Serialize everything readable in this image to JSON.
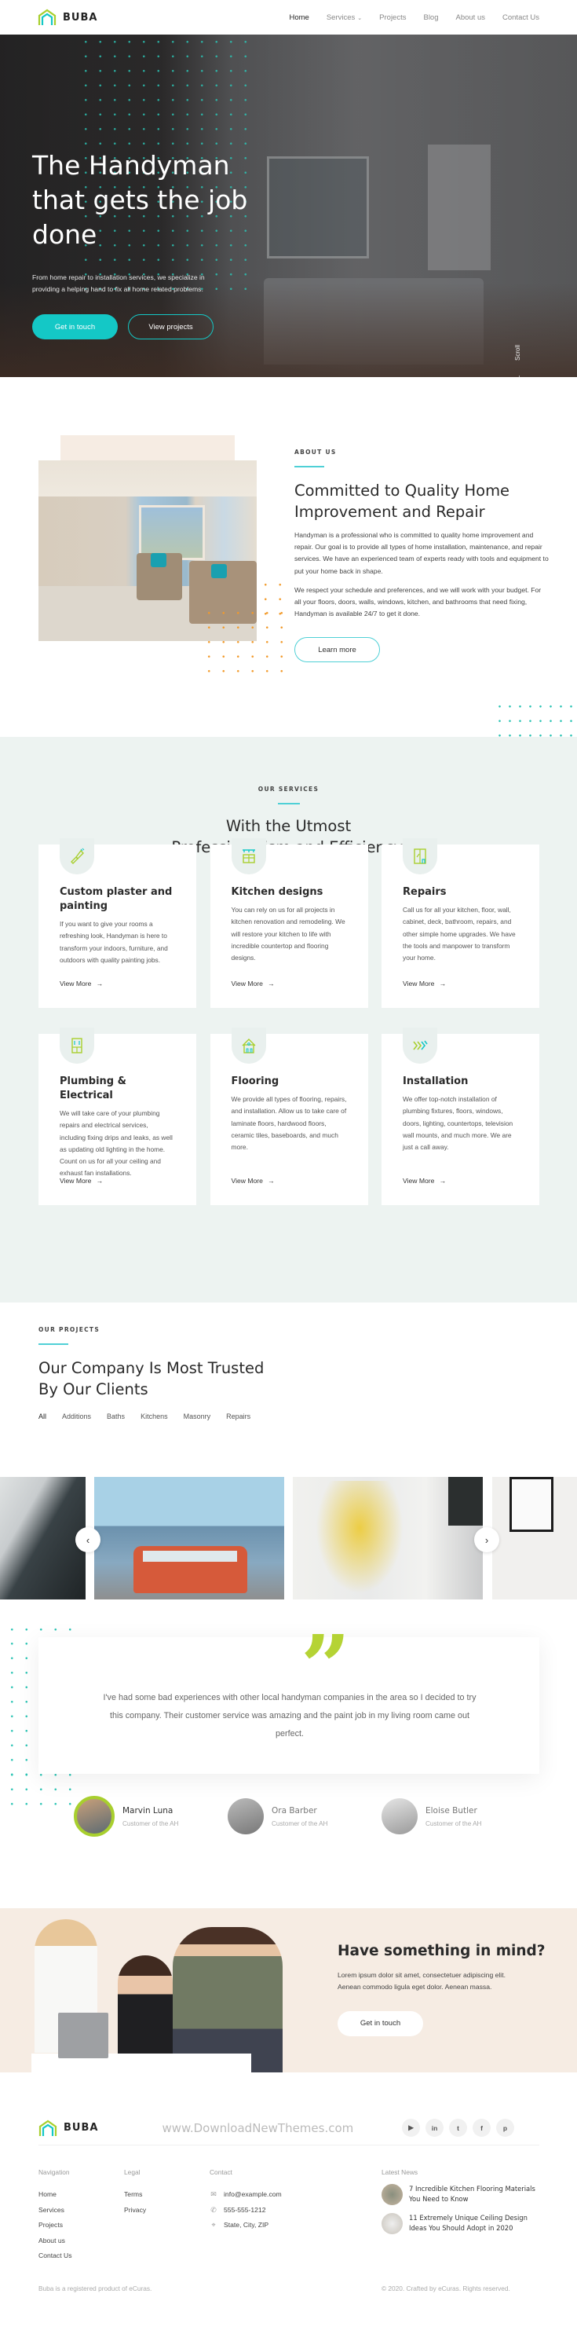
{
  "header": {
    "logo_text": "BUBA",
    "nav": [
      {
        "label": "Home",
        "active": true
      },
      {
        "label": "Services",
        "has_dropdown": true
      },
      {
        "label": "Projects"
      },
      {
        "label": "Blog"
      },
      {
        "label": "About us"
      },
      {
        "label": "Contact Us"
      }
    ],
    "dropdown_caret": "⌄"
  },
  "hero": {
    "title": "The Handyman that gets the job done",
    "subtitle": "From home repair to installation services, we specialize in providing a helping hand to fix all home related problems.",
    "primary_button": "Get in touch",
    "secondary_button": "View projects",
    "scroll_label": "Scroll"
  },
  "about": {
    "eyebrow": "ABOUT US",
    "title": "Committed to Quality Home Improvement and Repair",
    "paragraphs": [
      "Handyman is a professional who is committed to quality home improvement and repair. Our goal is to provide all types of home installation, maintenance, and repair services. We have an experienced team of experts ready with tools and equipment to put your home back in shape.",
      "We respect your schedule and preferences, and we will work with your budget. For all your floors, doors, walls, windows, kitchen, and bathrooms that need fixing, Handyman is available 24/7 to get it done."
    ],
    "button": "Learn more"
  },
  "services": {
    "eyebrow": "OUR SERVICES",
    "title_line1": "With the Utmost",
    "title_line2": "Professionalism and Efficiency.",
    "view_more_label": "View More",
    "arrow": "→",
    "items": [
      {
        "icon": "paint-brush-icon",
        "title": "Custom plaster and painting",
        "text": "If you want to give your rooms a refreshing look, Handyman is here to transform your indoors, furniture, and outdoors with quality painting jobs."
      },
      {
        "icon": "kitchen-cabinet-icon",
        "title": "Kitchen designs",
        "text": "You can rely on us for all projects in kitchen renovation and remodeling. We will restore your kitchen to life with incredible countertop and flooring designs."
      },
      {
        "icon": "window-repair-icon",
        "title": "Repairs",
        "text": "Call us for all your kitchen, floor, wall, cabinet, deck, bathroom, repairs, and other simple home upgrades. We have the tools and manpower to transform your home."
      },
      {
        "icon": "plumbing-cabinet-icon",
        "title": "Plumbing & Electrical",
        "text": "We will take care of your plumbing repairs and electrical services, including fixing drips and leaks, as well as updating old lighting in the home. Count on us for all your ceiling and exhaust fan installations."
      },
      {
        "icon": "house-icon",
        "title": "Flooring",
        "text": "We provide all types of flooring, repairs, and installation. Allow us to take care of laminate floors, hardwood floors, ceramic tiles, baseboards, and much more."
      },
      {
        "icon": "installation-icon",
        "title": "Installation",
        "text": "We offer top-notch installation of plumbing fixtures, floors, windows, doors, lighting, countertops, television wall mounts, and much more. We are just a call away."
      }
    ]
  },
  "projects": {
    "eyebrow": "OUR PROJECTS",
    "title_line1": "Our Company Is Most Trusted",
    "title_line2": "By Our Clients",
    "filters": [
      {
        "label": "All",
        "active": true
      },
      {
        "label": "Additions"
      },
      {
        "label": "Baths"
      },
      {
        "label": "Kitchens"
      },
      {
        "label": "Masonry"
      },
      {
        "label": "Repairs"
      }
    ],
    "prev_icon": "‹",
    "next_icon": "›"
  },
  "testimonials": {
    "quote_mark": "”",
    "quote": "I've had some bad experiences with other local handyman companies in the area so I decided to try this company. Their customer service was amazing and the paint job in my living room came out perfect.",
    "people": [
      {
        "name": "Marvin Luna",
        "role": "Customer of the AH",
        "active": true
      },
      {
        "name": "Ora Barber",
        "role": "Customer of the AH"
      },
      {
        "name": "Eloise Butler",
        "role": "Customer of the AH"
      }
    ]
  },
  "contact_cta": {
    "title": "Have something in mind?",
    "text": "Lorem ipsum dolor sit amet, consectetuer adipiscing elit. Aenean commodo ligula eget dolor. Aenean massa.",
    "button": "Get in touch"
  },
  "footer": {
    "logo_text": "BUBA",
    "watermark": "www.DownloadNewThemes.com",
    "socials": [
      {
        "name": "youtube",
        "glyph": "▶"
      },
      {
        "name": "linkedin",
        "glyph": "in"
      },
      {
        "name": "twitter",
        "glyph": "t"
      },
      {
        "name": "facebook",
        "glyph": "f"
      },
      {
        "name": "pinterest",
        "glyph": "p"
      }
    ],
    "navigation": {
      "heading": "Navigation",
      "items": [
        "Home",
        "Services",
        "Projects",
        "About us",
        "Contact Us"
      ]
    },
    "legal": {
      "heading": "Legal",
      "items": [
        "Terms",
        "Privacy"
      ]
    },
    "contact": {
      "heading": "Contact",
      "email": "info@example.com",
      "phone": "555-555-1212",
      "address": "State, City, ZIP"
    },
    "news": {
      "heading": "Latest News",
      "items": [
        "7 Incredible Kitchen Flooring Materials You Need to Know",
        "11 Extremely Unique Ceiling Design Ideas You Should Adopt in 2020"
      ]
    },
    "bottom_left": "Buba is a registered product of eCuras.",
    "bottom_right": "© 2020. Crafted by eCuras. Rights reserved."
  },
  "colors": {
    "accent_teal": "#14c8c6",
    "accent_green": "#b5d334",
    "services_bg": "#edf3f1",
    "cta_bg": "#f6ece3",
    "dots_orange": "#f29a2a"
  }
}
